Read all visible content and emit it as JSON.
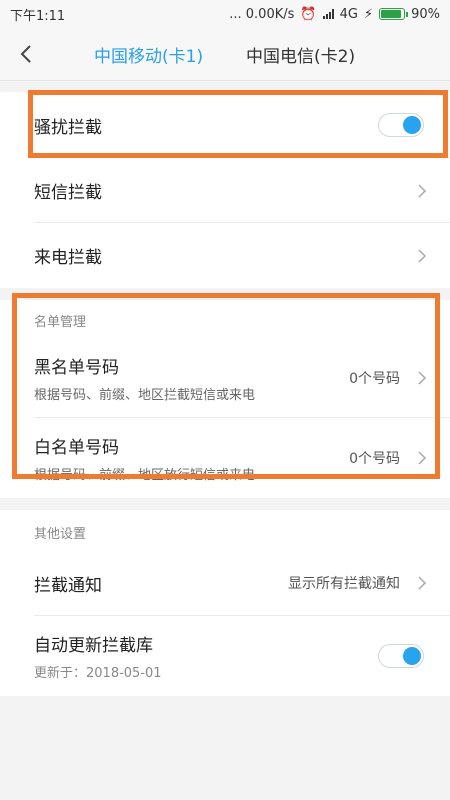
{
  "status": {
    "time": "下午1:11",
    "speed": "... 0.00K/s",
    "network": "4G",
    "battery": "90%",
    "battery_level": 0.9
  },
  "nav": {
    "back_icon": "chevron-left-icon",
    "tab_active": "中国移动(卡1)",
    "tab_inactive": "中国电信(卡2)"
  },
  "block": {
    "harass_label": "骚扰拦截",
    "harass_on": true,
    "sms_label": "短信拦截",
    "call_label": "来电拦截"
  },
  "list": {
    "header": "名单管理",
    "black_title": "黑名单号码",
    "black_sub": "根据号码、前缀、地区拦截短信或来电",
    "black_count": "0个号码",
    "white_title": "白名单号码",
    "white_sub": "根据号码、前缀、地区放行短信或来电",
    "white_count": "0个号码"
  },
  "other": {
    "header": "其他设置",
    "notify_label": "拦截通知",
    "notify_value": "显示所有拦截通知",
    "update_label": "自动更新拦截库",
    "update_sub": "更新于：2018-05-01",
    "update_on": true
  },
  "colors": {
    "accent": "#2aa0e8",
    "highlight": "#ee7b2f",
    "toggle_on": "#27a3ef"
  }
}
